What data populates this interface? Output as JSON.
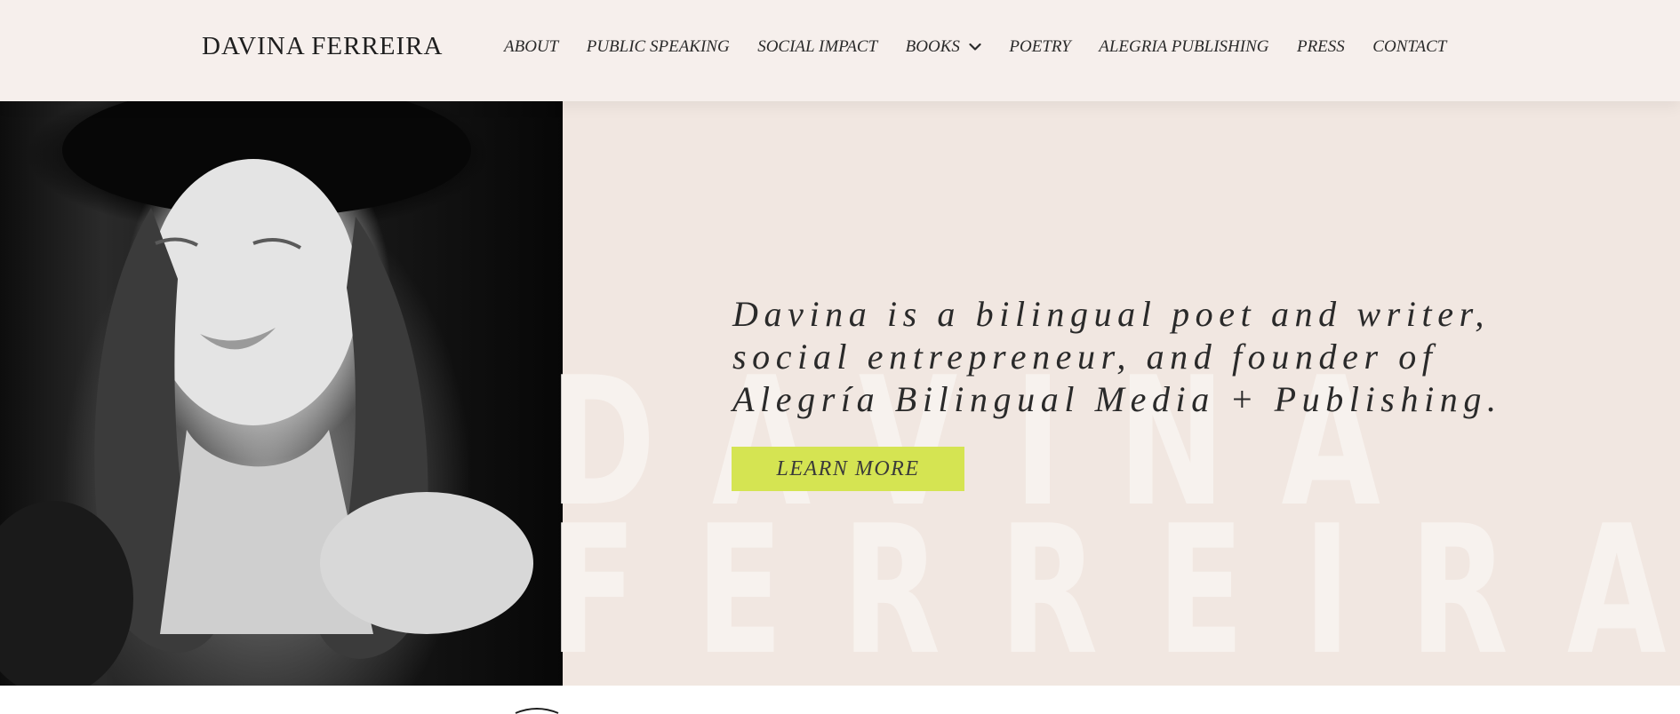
{
  "site": {
    "logo": "DAVINA FERREIRA"
  },
  "nav": {
    "items": [
      {
        "label": "ABOUT"
      },
      {
        "label": "PUBLIC SPEAKING"
      },
      {
        "label": "SOCIAL IMPACT"
      },
      {
        "label": "BOOKS",
        "has_dropdown": true
      },
      {
        "label": "POETRY"
      },
      {
        "label": "ALEGRIA PUBLISHING"
      },
      {
        "label": "PRESS"
      },
      {
        "label": "CONTACT"
      }
    ],
    "dropdown_icon": "chevron-down-icon"
  },
  "hero": {
    "background_word_1": "DAVINA",
    "background_word_2": "FERREIRA",
    "tagline_line_1": "Davina is a bilingual poet and writer,",
    "tagline_line_2": "social entrepreneur, and founder of",
    "tagline_line_3": "Alegría Bilingual Media + Publishing.",
    "cta_label": "LEARN MORE",
    "photo": "portrait-photo"
  },
  "colors": {
    "header_bg": "#f6efec",
    "hero_bg": "#f1e7e1",
    "cta_bg": "#d5e452",
    "text": "#2a2a2a"
  }
}
